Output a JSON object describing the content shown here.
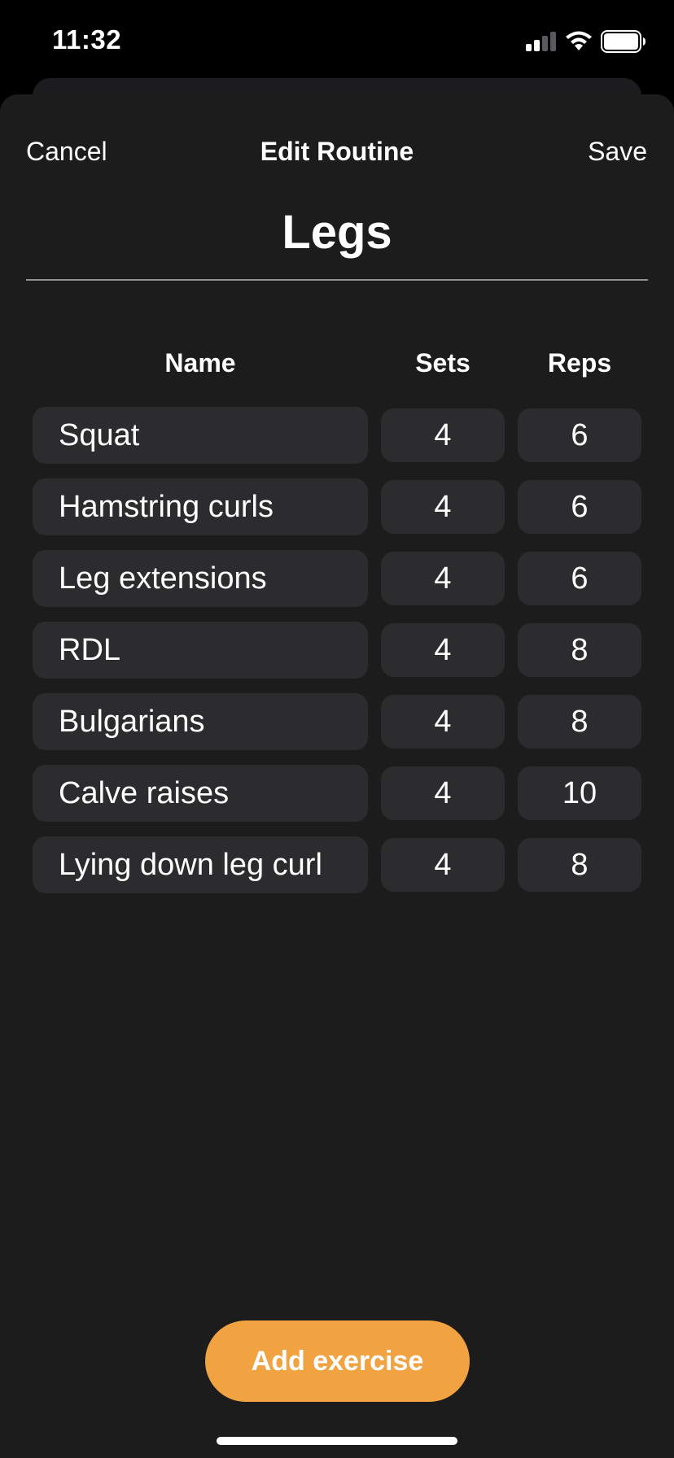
{
  "status_bar": {
    "time": "11:32",
    "icons": [
      "cellular-signal-icon",
      "wifi-icon",
      "battery-icon"
    ]
  },
  "nav": {
    "cancel_label": "Cancel",
    "title": "Edit Routine",
    "save_label": "Save"
  },
  "routine": {
    "name": "Legs"
  },
  "table": {
    "headers": {
      "name": "Name",
      "sets": "Sets",
      "reps": "Reps"
    },
    "rows": [
      {
        "name": "Squat",
        "sets": "4",
        "reps": "6"
      },
      {
        "name": "Hamstring curls",
        "sets": "4",
        "reps": "6"
      },
      {
        "name": "Leg extensions",
        "sets": "4",
        "reps": "6"
      },
      {
        "name": "RDL",
        "sets": "4",
        "reps": "8"
      },
      {
        "name": "Bulgarians",
        "sets": "4",
        "reps": "8"
      },
      {
        "name": "Calve raises",
        "sets": "4",
        "reps": "10"
      },
      {
        "name": "Lying down leg curl",
        "sets": "4",
        "reps": "8"
      }
    ]
  },
  "actions": {
    "add_exercise_label": "Add exercise"
  },
  "colors": {
    "background": "#000000",
    "sheet": "#1c1c1c",
    "field": "#2c2c2e",
    "accent": "#f2a341",
    "text": "#ffffff",
    "divider": "#8e8e93"
  }
}
